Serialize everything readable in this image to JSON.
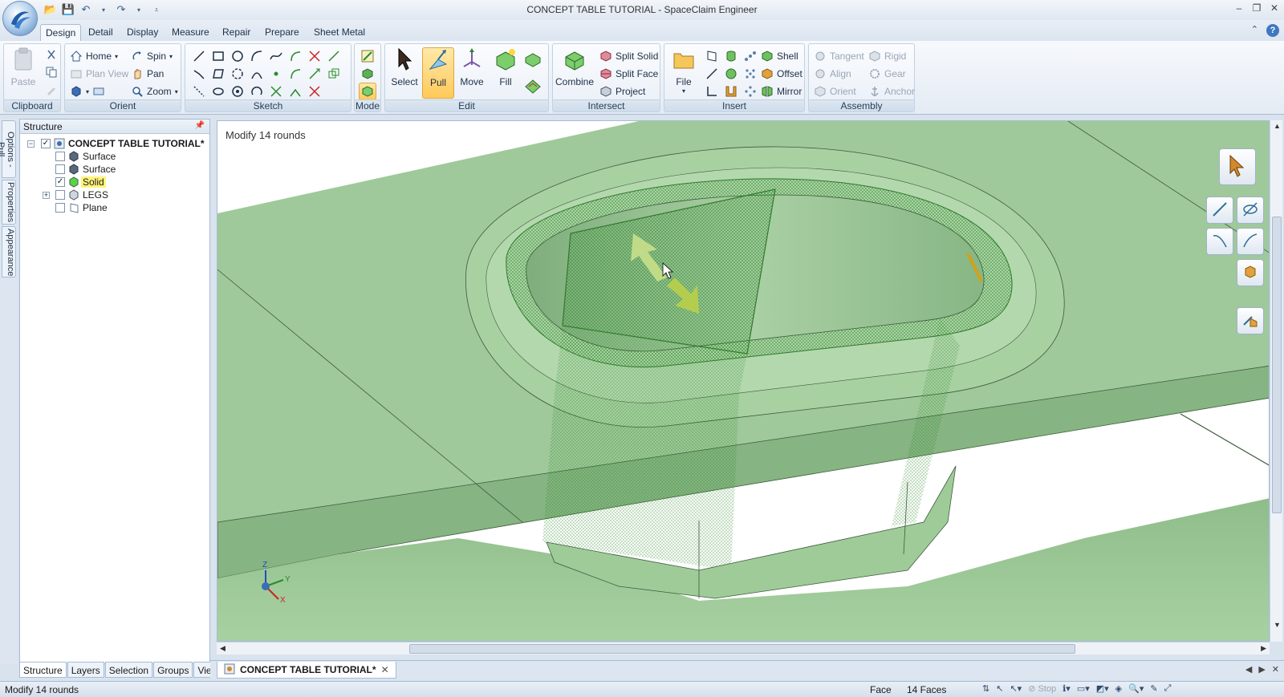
{
  "window": {
    "title": "CONCEPT TABLE TUTORIAL - SpaceClaim Engineer",
    "controls": [
      "–",
      "❐",
      "✕"
    ]
  },
  "qat": {
    "items": [
      "open-icon",
      "save-icon",
      "undo-icon",
      "redo-icon",
      "customize-icon"
    ]
  },
  "tabs": [
    "Design",
    "Detail",
    "Display",
    "Measure",
    "Repair",
    "Prepare",
    "Sheet Metal"
  ],
  "ribbon": {
    "clipboard": {
      "label": "Clipboard",
      "paste": "Paste"
    },
    "orient": {
      "label": "Orient",
      "home": "Home",
      "spin": "Spin",
      "plan_view": "Plan View",
      "pan": "Pan",
      "zoom": "Zoom"
    },
    "sketch": {
      "label": "Sketch"
    },
    "mode": {
      "label": "Mode"
    },
    "edit": {
      "label": "Edit",
      "select": "Select",
      "pull": "Pull",
      "move": "Move",
      "fill": "Fill"
    },
    "intersect": {
      "label": "Intersect",
      "combine": "Combine",
      "split_solid": "Split Solid",
      "split_face": "Split Face",
      "project": "Project"
    },
    "insert": {
      "label": "Insert",
      "file": "File",
      "shell": "Shell",
      "offset": "Offset",
      "mirror": "Mirror"
    },
    "assembly": {
      "label": "Assembly",
      "tangent": "Tangent",
      "rigid": "Rigid",
      "align": "Align",
      "gear": "Gear",
      "orient": "Orient",
      "anchor": "Anchor"
    }
  },
  "side_tabs": [
    "Options - Pull",
    "Properties",
    "Appearance"
  ],
  "structure": {
    "title": "Structure",
    "root": "CONCEPT TABLE TUTORIAL*",
    "items": [
      {
        "label": "Surface",
        "checked": false
      },
      {
        "label": "Surface",
        "checked": false
      },
      {
        "label": "Solid",
        "checked": true
      },
      {
        "label": "LEGS",
        "checked": false
      },
      {
        "label": "Plane",
        "checked": false
      }
    ]
  },
  "bottom_tabs": [
    "Structure",
    "Layers",
    "Selection",
    "Groups",
    "Views"
  ],
  "viewport": {
    "hint": "Modify 14 rounds"
  },
  "document_tab": "CONCEPT TABLE TUTORIAL*",
  "status": {
    "message": "Modify 14 rounds",
    "type": "Face",
    "count": "14 Faces",
    "stop": "Stop"
  },
  "colors": {
    "model_face": "#9fc99a",
    "model_dark": "#7fae7c",
    "selection": "#3f9a3a",
    "accent": "#ffc95a"
  }
}
